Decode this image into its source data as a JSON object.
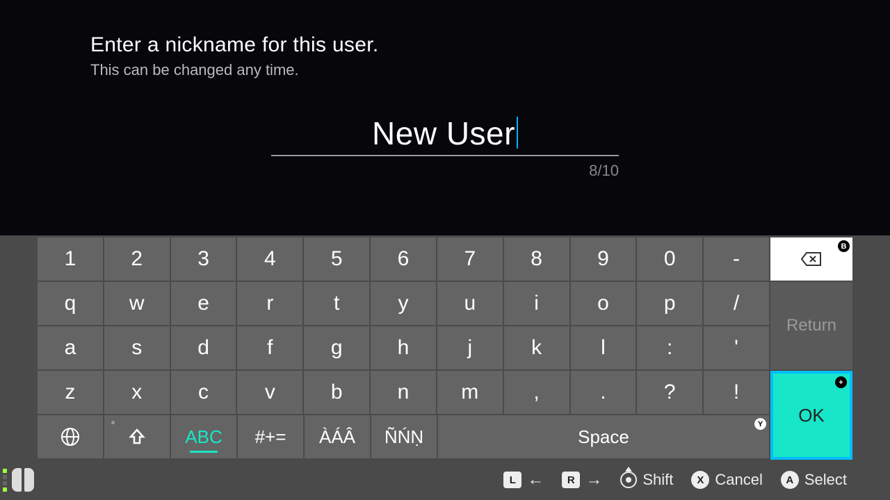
{
  "header": {
    "title": "Enter a nickname for this user.",
    "subtitle": "This can be changed any time."
  },
  "input": {
    "value": "New User",
    "counter": "8/10"
  },
  "keyboard": {
    "row1": [
      "1",
      "2",
      "3",
      "4",
      "5",
      "6",
      "7",
      "8",
      "9",
      "0",
      "-"
    ],
    "row2": [
      "q",
      "w",
      "e",
      "r",
      "t",
      "y",
      "u",
      "i",
      "o",
      "p",
      "/"
    ],
    "row3": [
      "a",
      "s",
      "d",
      "f",
      "g",
      "h",
      "j",
      "k",
      "l",
      ":",
      "'"
    ],
    "row4": [
      "z",
      "x",
      "c",
      "v",
      "b",
      "n",
      "m",
      ",",
      ".",
      "?",
      "!"
    ],
    "bottom": {
      "abc": "ABC",
      "sym": "#+=",
      "accent1": "ÀÁÂ",
      "accent2": "ÑŃṆ",
      "space": "Space"
    },
    "side": {
      "return": "Return",
      "ok": "OK",
      "backspace_hint": "B",
      "ok_hint": "+",
      "space_hint": "Y"
    }
  },
  "controls": {
    "l": "L",
    "r": "R",
    "shift": "Shift",
    "cancel": "Cancel",
    "cancel_btn": "X",
    "select": "Select",
    "select_btn": "A"
  }
}
